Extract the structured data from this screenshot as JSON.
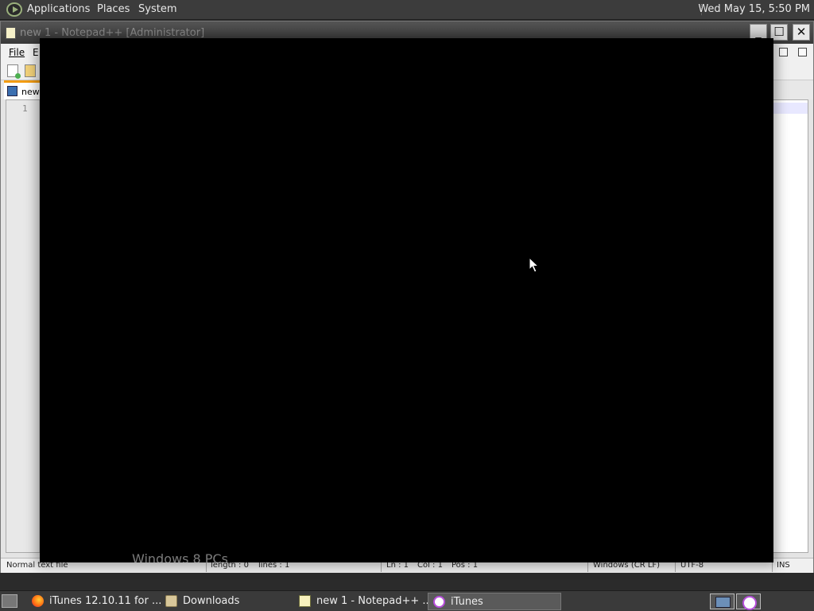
{
  "top_panel": {
    "menus": [
      "Applications",
      "Places",
      "System"
    ],
    "clock": "Wed May 15,  5:50 PM"
  },
  "notepad": {
    "title": "new 1 - Notepad++ [Administrator]",
    "menubar": {
      "file": "File",
      "edit": "E"
    },
    "tab_label": "new",
    "line_number": "1",
    "status": {
      "filetype": "Normal text file",
      "length": "length : 0",
      "lines": "lines : 1",
      "ln": "Ln : 1",
      "col": "Col : 1",
      "pos": "Pos : 1",
      "eol": "Windows (CR LF)",
      "encoding": "UTF-8",
      "mode": "INS"
    }
  },
  "itunes_window": {
    "ghost_text": "Windows 8 PCs"
  },
  "taskbar": {
    "items": [
      {
        "label": "iTunes 12.10.11 for ...",
        "icon": "firefox-icon"
      },
      {
        "label": "Downloads",
        "icon": "folder-icon"
      },
      {
        "label": "new 1 - Notepad++ ...",
        "icon": "notepad-icon"
      },
      {
        "label": "iTunes",
        "icon": "itunes-icon"
      }
    ]
  },
  "colors": {
    "panel": "#3c3c3c",
    "itunes_background": "#000000",
    "tab_accent": "#f39c12"
  }
}
